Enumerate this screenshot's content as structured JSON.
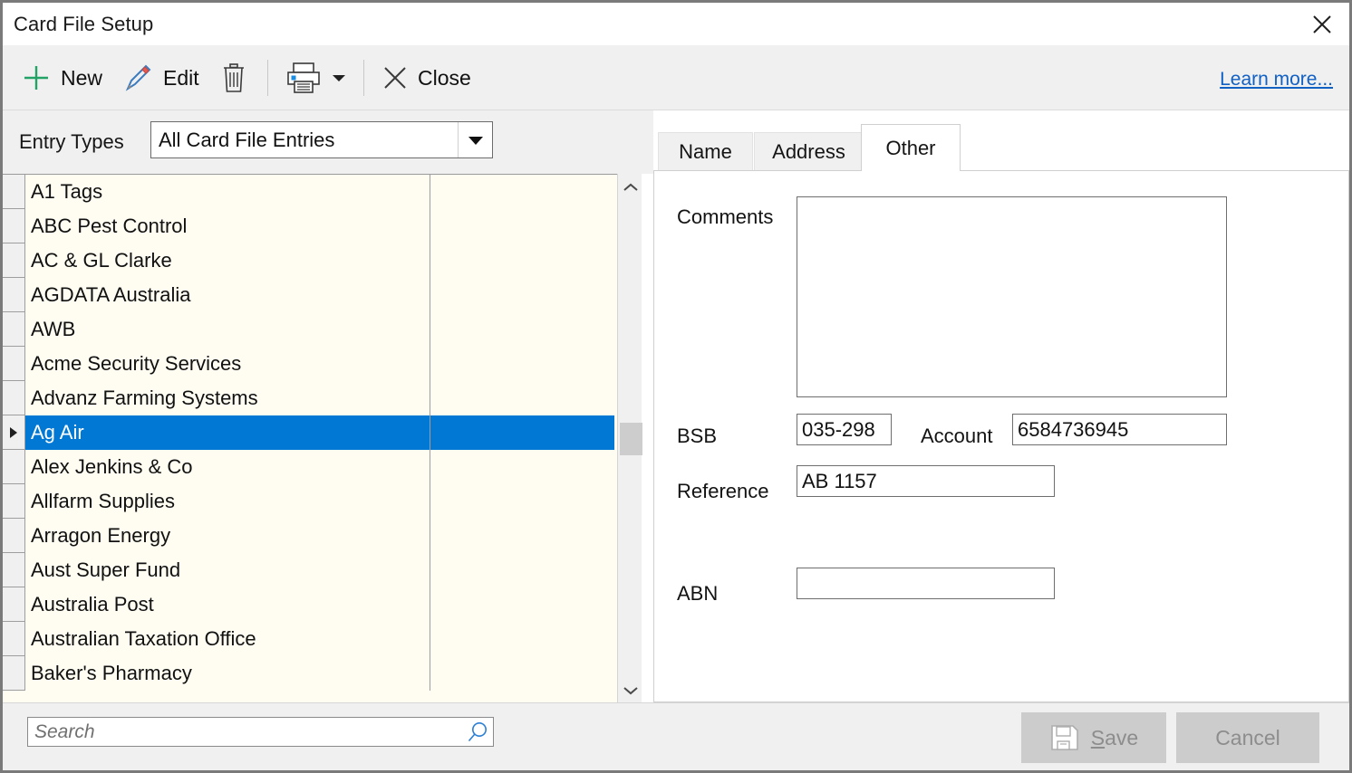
{
  "window": {
    "title": "Card File Setup",
    "close_icon": "close-icon"
  },
  "toolbar": {
    "new_label": "New",
    "edit_label": "Edit",
    "delete_icon": "trash-icon",
    "print_icon": "printer-icon",
    "print_dropdown_icon": "chevron-down-icon",
    "close_label": "Close",
    "learn_more_label": "Learn more...",
    "accent_green": "#21a366",
    "link_blue": "#1160c4"
  },
  "filter": {
    "entry_types_label": "Entry Types",
    "entry_types_value": "All Card File Entries",
    "dropdown_icon": "dropdown-arrow-icon"
  },
  "list": {
    "selected_index": 7,
    "selection_color": "#0078d4",
    "background_color": "#fffdf2",
    "rows": [
      {
        "name": "A1 Tags"
      },
      {
        "name": "ABC Pest Control"
      },
      {
        "name": "AC & GL Clarke"
      },
      {
        "name": "AGDATA Australia"
      },
      {
        "name": "AWB"
      },
      {
        "name": "Acme Security Services"
      },
      {
        "name": "Advanz Farming Systems"
      },
      {
        "name": "Ag Air"
      },
      {
        "name": "Alex Jenkins & Co"
      },
      {
        "name": "Allfarm Supplies"
      },
      {
        "name": "Arragon Energy"
      },
      {
        "name": "Aust Super Fund"
      },
      {
        "name": "Australia Post"
      },
      {
        "name": "Australian Taxation Office"
      },
      {
        "name": "Baker's Pharmacy"
      }
    ],
    "scroll_up_icon": "chevron-up-icon",
    "scroll_down_icon": "chevron-down-icon"
  },
  "search": {
    "value": "",
    "placeholder": "Search",
    "icon": "search-icon"
  },
  "tabs": [
    {
      "label": "Name",
      "active": false
    },
    {
      "label": "Address",
      "active": false
    },
    {
      "label": "Other",
      "active": true
    }
  ],
  "form": {
    "comments_label": "Comments",
    "comments_value": "",
    "bsb_label": "BSB",
    "bsb_value": "035-298",
    "account_label": "Account",
    "account_value": "6584736945",
    "reference_label": "Reference",
    "reference_value": "AB 1157",
    "abn_label": "ABN",
    "abn_value": ""
  },
  "footer": {
    "save_label_accel": "S",
    "save_label_rest": "ave",
    "save_icon": "save-disk-icon",
    "save_enabled": false,
    "cancel_label": "Cancel",
    "cancel_enabled": false
  }
}
